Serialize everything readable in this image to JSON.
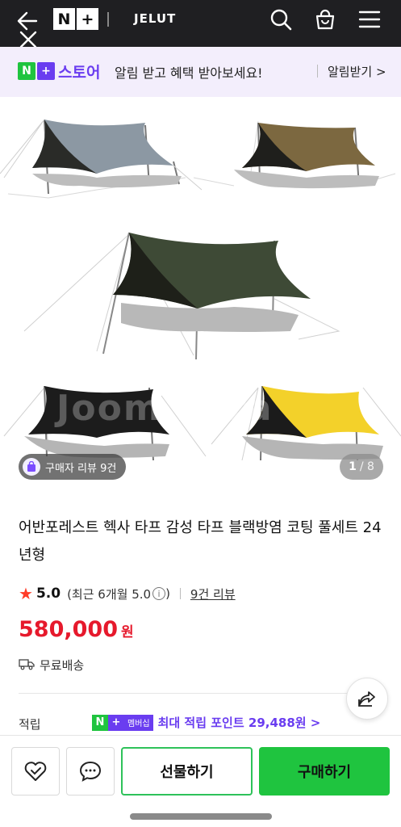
{
  "topbar": {
    "logo_n": "N",
    "logo_plus": "+",
    "brand": "JELUT"
  },
  "notice": {
    "badge_n": "N",
    "badge_plus": "+",
    "store": "스토어",
    "text": "알림 받고 혜택 받아보세요!",
    "action": "알림받기 >"
  },
  "hero": {
    "review_chip": "구매자 리뷰 9건",
    "page_current": "1",
    "page_total": "/ 8",
    "watermark": "Joom  nara"
  },
  "product": {
    "title": "어반포레스트 헥사 타프 감성 타프 블랙방염 코팅 풀세트 24년형",
    "rating": "5.0",
    "recent": "(최근 6개월 5.0",
    "recent_close": ")",
    "info_i": "i",
    "review_count": "9건 리뷰",
    "price": "580,000",
    "price_unit": "원",
    "shipping": "무료배송",
    "points_label": "적립",
    "points_badge_n": "N",
    "points_badge_plus": "+",
    "points_badge_member": "멤버십",
    "points_text": "최대 적립 포인트 29,488원 >"
  },
  "actions": {
    "gift": "선물하기",
    "buy": "구매하기"
  },
  "colors": {
    "accent_purple": "#6a3df0",
    "naver_green": "#1fc43f",
    "price_red": "#e6192c"
  }
}
